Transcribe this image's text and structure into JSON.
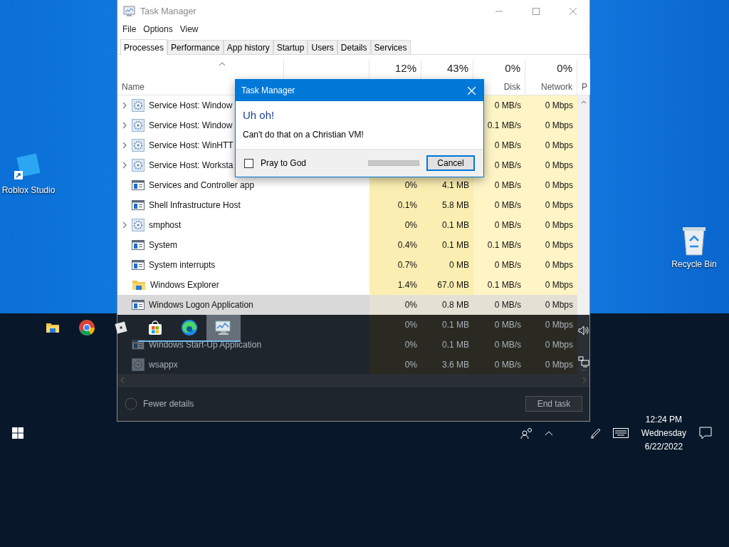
{
  "desktop_icons": [
    {
      "label": "Roblox Studio",
      "kind": "roblox-studio"
    },
    {
      "label": "Recycle Bin",
      "kind": "recycle-bin"
    }
  ],
  "task_manager": {
    "title": "Task Manager",
    "menu": [
      "File",
      "Options",
      "View"
    ],
    "tabs": [
      {
        "label": "Processes",
        "selected": true
      },
      {
        "label": "Performance",
        "selected": false
      },
      {
        "label": "App history",
        "selected": false
      },
      {
        "label": "Startup",
        "selected": false
      },
      {
        "label": "Users",
        "selected": false
      },
      {
        "label": "Details",
        "selected": false
      },
      {
        "label": "Services",
        "selected": false
      }
    ],
    "columns": [
      {
        "label": "Name"
      },
      {
        "percent": "12%"
      },
      {
        "percent": "43%"
      },
      {
        "percent": "0%",
        "label": "Disk"
      },
      {
        "percent": "0%",
        "label": "Network"
      },
      {
        "label": "P"
      }
    ],
    "rows": [
      {
        "name": "Service Host: Window",
        "kind": "service",
        "expandable": true,
        "selected": false,
        "disk": "0 MB/s",
        "network": "0 Mbps"
      },
      {
        "name": "Service Host: Window",
        "kind": "service",
        "expandable": true,
        "selected": false,
        "disk": "0.1 MB/s",
        "network": "0 Mbps"
      },
      {
        "name": "Service Host: WinHTT",
        "kind": "service",
        "expandable": true,
        "selected": false,
        "disk": "0 MB/s",
        "network": "0 Mbps"
      },
      {
        "name": "Service Host: Worksta",
        "kind": "service",
        "expandable": true,
        "selected": false,
        "disk": "0 MB/s",
        "network": "0 Mbps"
      },
      {
        "name": "Services and Controller app",
        "kind": "app",
        "expandable": false,
        "selected": false,
        "cpu": "0%",
        "memory": "4.1 MB",
        "disk": "0 MB/s",
        "network": "0 Mbps"
      },
      {
        "name": "Shell Infrastructure Host",
        "kind": "app",
        "expandable": false,
        "selected": false,
        "cpu": "0.1%",
        "memory": "5.8 MB",
        "disk": "0 MB/s",
        "network": "0 Mbps"
      },
      {
        "name": "smphost",
        "kind": "service",
        "expandable": true,
        "selected": false,
        "cpu": "0%",
        "memory": "0.1 MB",
        "disk": "0 MB/s",
        "network": "0 Mbps"
      },
      {
        "name": "System",
        "kind": "app",
        "expandable": false,
        "selected": false,
        "cpu": "0.4%",
        "memory": "0.1 MB",
        "disk": "0.1 MB/s",
        "network": "0 Mbps"
      },
      {
        "name": "System interrupts",
        "kind": "app",
        "expandable": false,
        "selected": false,
        "cpu": "0.7%",
        "memory": "0 MB",
        "disk": "0 MB/s",
        "network": "0 Mbps"
      },
      {
        "name": "Windows Explorer",
        "kind": "folder",
        "expandable": false,
        "selected": false,
        "cpu": "1.4%",
        "memory": "67.0 MB",
        "disk": "0.1 MB/s",
        "network": "0 Mbps"
      },
      {
        "name": "Windows Logon Application",
        "kind": "app",
        "expandable": false,
        "selected": true,
        "cpu": "0%",
        "memory": "0.8 MB",
        "disk": "0 MB/s",
        "network": "0 Mbps"
      },
      {
        "expandable": false,
        "selected": false,
        "cpu": "0%",
        "memory": "0.1 MB",
        "disk": "0 MB/s",
        "network": "0 Mbps"
      },
      {
        "name": "Windows Start-Up Application",
        "kind": "app",
        "expandable": false,
        "selected": false,
        "cpu": "0%",
        "memory": "0.1 MB",
        "disk": "0 MB/s",
        "network": "0 Mbps"
      },
      {
        "name": "wsappx",
        "kind": "service",
        "expandable": false,
        "selected": false,
        "cpu": "0%",
        "memory": "3.6 MB",
        "disk": "0 MB/s",
        "network": "0 Mbps"
      }
    ],
    "fewer_details": "Fewer details",
    "end_task": "End task"
  },
  "dialog": {
    "title": "Task Manager",
    "heading": "Uh oh!",
    "message": "Can't do that on a Christian VM!",
    "checkbox": {
      "label": "Pray to God",
      "checked": false
    },
    "progress": {
      "level": 0
    },
    "button": "Cancel"
  },
  "taskbar": {
    "apps": [
      {
        "kind": "folder",
        "running": false,
        "selected": false
      },
      {
        "kind": "chrome",
        "running": false,
        "selected": false
      },
      {
        "kind": "roblox",
        "running": false,
        "selected": false
      },
      {
        "kind": "store",
        "running": true,
        "selected": false
      },
      {
        "kind": "edge",
        "running": true,
        "selected": false
      },
      {
        "kind": "monitor",
        "running": true,
        "selected": true
      }
    ],
    "clock": {
      "time": "12:24 PM",
      "day": "Wednesday",
      "date": "6/22/2022"
    }
  }
}
